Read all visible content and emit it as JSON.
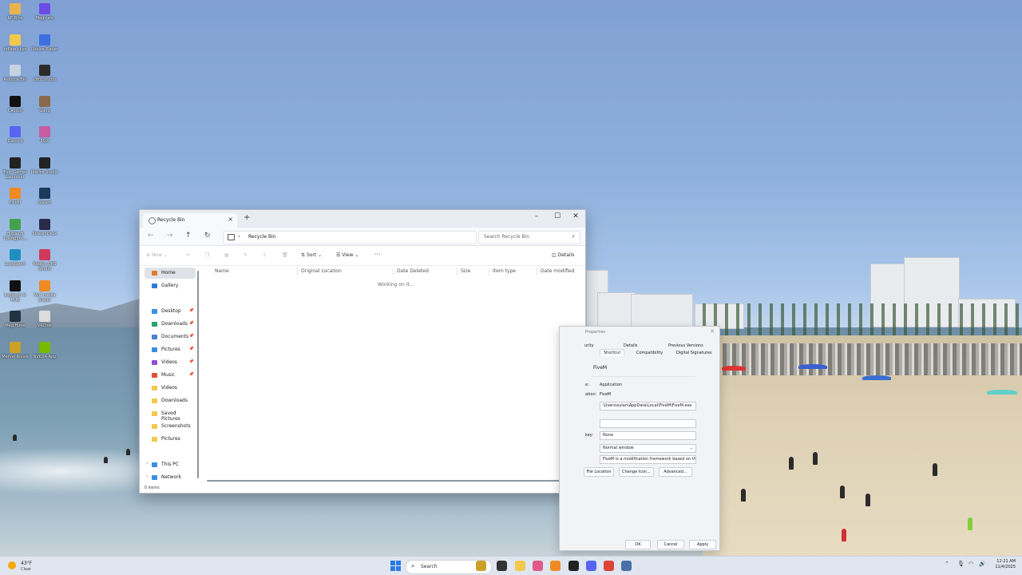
{
  "desktop": {
    "icons": [
      {
        "label": "RE Bins",
        "color": "#e9b44c"
      },
      {
        "label": "Magicam",
        "color": "#6b4de6"
      },
      {
        "label": "offline-clips",
        "color": "#f2c94c"
      },
      {
        "label": "Roblox Player",
        "color": "#3d6fe0"
      },
      {
        "label": "Recycle Bin",
        "color": "#c7d3e0"
      },
      {
        "label": "OBS Studio",
        "color": "#2b2b2b"
      },
      {
        "label": "CapCut",
        "color": "#111111"
      },
      {
        "label": "Gang",
        "color": "#8a6a4a"
      },
      {
        "label": "Discord",
        "color": "#5865f2"
      },
      {
        "label": "PSiX",
        "color": "#c85ca0"
      },
      {
        "label": "Epic Games Launcher",
        "color": "#222222"
      },
      {
        "label": "Roblox Studio",
        "color": "#222222"
      },
      {
        "label": "FiveM",
        "color": "#f08a24"
      },
      {
        "label": "Steam",
        "color": "#1b3a5a"
      },
      {
        "label": "HiddenB Configura...",
        "color": "#44a04a"
      },
      {
        "label": "StreamDeck",
        "color": "#2a2a4a"
      },
      {
        "label": "LocalSend",
        "color": "#1f8fbf"
      },
      {
        "label": "Roblox OBS Studio",
        "color": "#d03a5a"
      },
      {
        "label": "Logitech G HUB",
        "color": "#111111"
      },
      {
        "label": "VLC media player",
        "color": "#f08a24"
      },
      {
        "label": "Meg Hime",
        "color": "#223344"
      },
      {
        "label": "VRChat",
        "color": "#dddddd"
      },
      {
        "label": "Marvel Rivals",
        "color": "#c9a227"
      },
      {
        "label": "NVIDIA App",
        "color": "#76b900"
      }
    ]
  },
  "explorer": {
    "tab_title": "Recycle Bin",
    "breadcrumb": "Recycle Bin",
    "search_placeholder": "Search Recycle Bin",
    "toolbar": {
      "new": "New",
      "sort": "Sort",
      "view": "View",
      "more": "···",
      "details": "Details"
    },
    "sidebar": [
      {
        "label": "Home",
        "icon": "home-icon",
        "color": "#e07a2e",
        "pinned": false,
        "selected": true
      },
      {
        "label": "Gallery",
        "icon": "gallery-icon",
        "color": "#2e7be0",
        "pinned": false
      },
      {
        "label": "Desktop",
        "icon": "desktop-icon",
        "color": "#3a8ee6",
        "pinned": true
      },
      {
        "label": "Downloads",
        "icon": "downloads-icon",
        "color": "#2aa36b",
        "pinned": true
      },
      {
        "label": "Documents",
        "icon": "documents-icon",
        "color": "#4a7fd6",
        "pinned": true
      },
      {
        "label": "Pictures",
        "icon": "pictures-icon",
        "color": "#3a8ee6",
        "pinned": true
      },
      {
        "label": "Videos",
        "icon": "videos-icon",
        "color": "#8a4fd6",
        "pinned": true
      },
      {
        "label": "Music",
        "icon": "music-icon",
        "color": "#e0503a",
        "pinned": true
      },
      {
        "label": "Videos",
        "icon": "folder-icon",
        "color": "#f2c94c",
        "pinned": false
      },
      {
        "label": "Downloads",
        "icon": "folder-icon",
        "color": "#f2c94c",
        "pinned": false
      },
      {
        "label": "Saved Pictures",
        "icon": "folder-icon",
        "color": "#f2c94c",
        "pinned": false
      },
      {
        "label": "Screenshots",
        "icon": "folder-icon",
        "color": "#f2c94c",
        "pinned": false
      },
      {
        "label": "Pictures",
        "icon": "folder-icon",
        "color": "#f2c94c",
        "pinned": false
      },
      {
        "label": "This PC",
        "icon": "this-pc-icon",
        "color": "#3a8ee6",
        "pinned": false
      },
      {
        "label": "Network",
        "icon": "network-icon",
        "color": "#3a8ee6",
        "pinned": false
      }
    ],
    "columns": [
      "Name",
      "Original Location",
      "Date Deleted",
      "Size",
      "Item type",
      "Date modified"
    ],
    "working_text": "Working on it...",
    "status": "0 items"
  },
  "properties": {
    "title": "Properties",
    "tabs_row1": [
      "urity",
      "Details",
      "Previous Versions"
    ],
    "tabs_row2": [
      "Shortcut",
      "Compatibility",
      "Digital Signatures"
    ],
    "name": "FiveM",
    "rows": [
      {
        "label": "e:",
        "value": "Application"
      },
      {
        "label": "ation:",
        "value": "FiveM"
      }
    ],
    "target": "\\Users\\eylan\\AppData\\Local\\FiveM\\FiveM.exe",
    "hotkey_label": "key:",
    "hotkey": "None",
    "run": "Normal window",
    "comment": "FiveM is a modification framework based on the C",
    "buttons": [
      "File Location",
      "Change Icon...",
      "Advanced..."
    ],
    "footer": [
      "OK",
      "Cancel",
      "Apply"
    ]
  },
  "taskbar": {
    "weather_temp": "43°F",
    "weather_cond": "Clear",
    "search_label": "Search",
    "time": "12:21 AM",
    "date": "11/4/2025",
    "apps": [
      {
        "name": "widgets",
        "color": "#c9a227"
      },
      {
        "name": "task-view",
        "color": "#333333"
      },
      {
        "name": "file-explorer",
        "color": "#f2c94c"
      },
      {
        "name": "music-app",
        "color": "#e05a8a"
      },
      {
        "name": "fivem-app",
        "color": "#f08a24"
      },
      {
        "name": "obs-app",
        "color": "#222222"
      },
      {
        "name": "discord-app",
        "color": "#5865f2"
      },
      {
        "name": "chrome-app",
        "color": "#db4437"
      },
      {
        "name": "settings-app",
        "color": "#4a6fa5"
      }
    ]
  }
}
